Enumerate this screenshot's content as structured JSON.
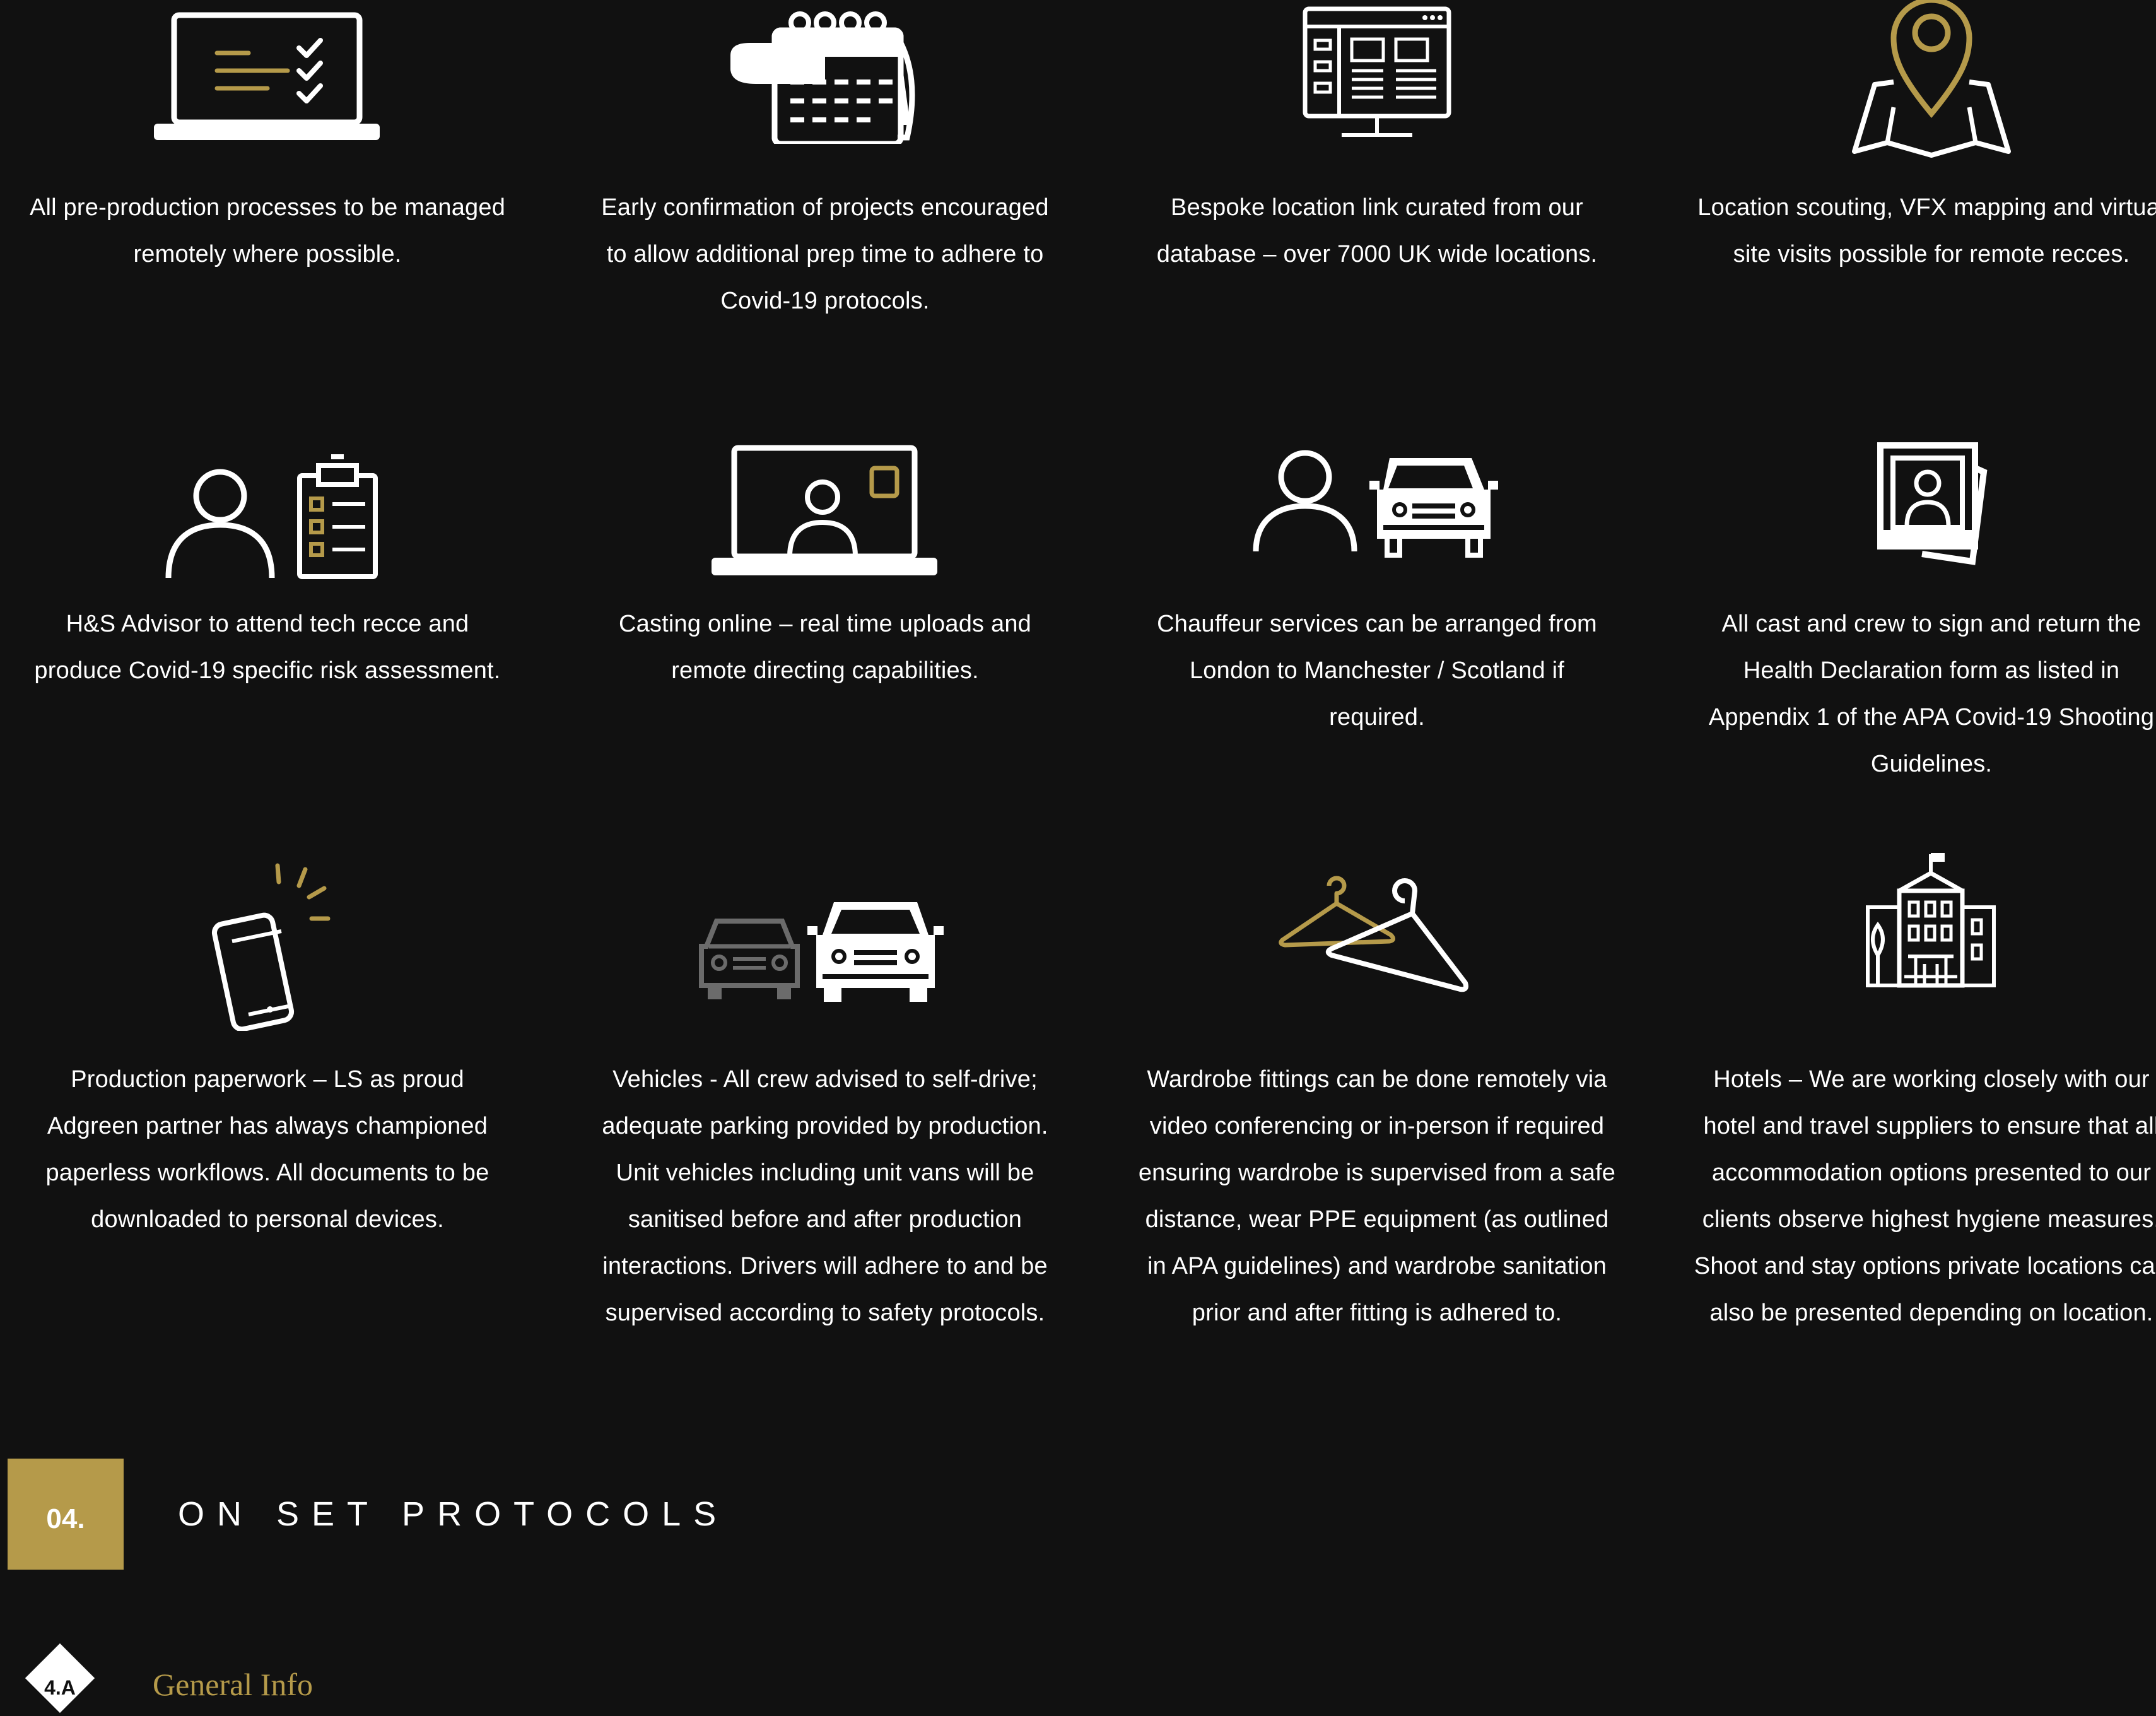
{
  "colors": {
    "background": "#111111",
    "gold": "#b59a4a",
    "white": "#ffffff",
    "grey": "#6b6b6b"
  },
  "items": [
    {
      "icon": "laptop-checklist-icon",
      "text": "All pre-production processes to be managed remotely where possible."
    },
    {
      "icon": "calendar-icon",
      "text": "Early confirmation of projects encouraged to allow additional prep time to adhere to Covid-19 protocols."
    },
    {
      "icon": "browser-window-icon",
      "text": "Bespoke location link curated from our database – over 7000 UK wide locations."
    },
    {
      "icon": "map-pin-icon",
      "text": "Location scouting, VFX mapping and virtual site visits possible for remote recces."
    },
    {
      "icon": "person-clipboard-icon",
      "text": "H&S Advisor to attend tech recce and produce Covid-19 specific risk assessment."
    },
    {
      "icon": "video-call-laptop-icon",
      "text": "Casting online – real time uploads and remote directing capabilities."
    },
    {
      "icon": "person-car-icon",
      "text": "Chauffeur services can be arranged from London to Manchester / Scotland if required."
    },
    {
      "icon": "photo-stack-icon",
      "text": "All cast and crew to sign and return the Health Declaration form as listed in Appendix 1 of the APA Covid-19 Shooting Guidelines."
    },
    {
      "icon": "smartphone-icon",
      "text": "Production paperwork – LS as proud Adgreen partner has always championed paperless workflows. All documents to be downloaded to personal devices."
    },
    {
      "icon": "two-cars-icon",
      "text": "Vehicles - All crew advised to self-drive; adequate parking provided by production. Unit vehicles including unit vans will be sanitised before and after production interactions. Drivers will adhere to and be supervised according to safety protocols."
    },
    {
      "icon": "clothes-hanger-icon",
      "text": "Wardrobe fittings can be done remotely via video conferencing or in-person if required ensuring wardrobe is supervised from a safe distance, wear PPE equipment (as outlined in APA guidelines) and wardrobe sanitation prior and after fitting is adhered to."
    },
    {
      "icon": "hotel-building-icon",
      "text": "Hotels – We are working closely with our hotel and travel suppliers to ensure that all accommodation options presented to our clients observe highest hygiene measures. Shoot and stay options private locations can also be presented depending on location."
    }
  ],
  "lines": [
    [
      "All pre-production processes to be managed",
      "remotely where possible."
    ],
    [
      "Early confirmation of projects encouraged",
      "to allow additional prep time to adhere to",
      "Covid-19 protocols."
    ],
    [
      "Bespoke location link curated from our",
      "database – over 7000 UK wide locations."
    ],
    [
      "Location scouting, VFX mapping and virtual",
      "site visits possible for remote recces."
    ],
    [
      "H&S Advisor to attend tech recce and",
      "produce Covid-19 specific risk assessment."
    ],
    [
      "Casting online – real time uploads and",
      "remote directing capabilities."
    ],
    [
      "Chauffeur services can be arranged from",
      "London to Manchester / Scotland if",
      "required."
    ],
    [
      "All cast and crew to sign and return the",
      "Health Declaration form as listed in",
      "Appendix 1 of the APA Covid-19 Shooting",
      "Guidelines."
    ],
    [
      "Production paperwork – LS as proud",
      "Adgreen partner has always championed",
      "paperless workflows. All documents to be",
      "downloaded to personal devices."
    ],
    [
      "Vehicles - All crew advised to self-drive;",
      "adequate parking provided by production.",
      "Unit vehicles including unit vans will be",
      "sanitised before and after production",
      "interactions. Drivers will adhere to and be",
      "supervised according to safety protocols."
    ],
    [
      "Wardrobe fittings can be done remotely via",
      "video conferencing or in-person if required",
      "ensuring wardrobe is supervised from a safe",
      "distance, wear PPE equipment (as outlined",
      "in APA guidelines) and wardrobe sanitation",
      "prior and after fitting is adhered to."
    ],
    [
      "Hotels – We are working closely with our",
      "hotel and travel suppliers to ensure that all",
      "accommodation options presented to our",
      "clients observe highest hygiene measures.",
      "Shoot and stay options private locations can",
      "also be presented depending on location."
    ]
  ],
  "section": {
    "number": "04.",
    "title": "ON SET PROTOCOLS"
  },
  "subsection": {
    "number": "4.A",
    "title": "General Info"
  }
}
